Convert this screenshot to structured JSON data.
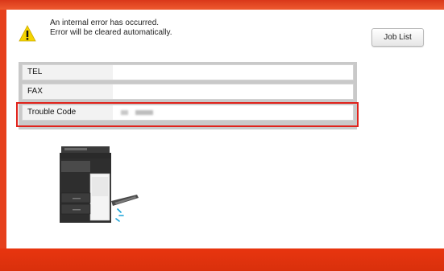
{
  "message": {
    "line1": "An internal error has occurred.",
    "line2": "Error will be cleared automatically."
  },
  "job_list_button": "Job List",
  "info_rows": [
    {
      "label": "TEL",
      "value": ""
    },
    {
      "label": "FAX",
      "value": ""
    },
    {
      "label": "Trouble Code",
      "value": ""
    }
  ],
  "icons": {
    "warning": "warning-icon",
    "printer": "printer-illustration"
  },
  "colors": {
    "frame": "#e6401c",
    "highlight_border": "#e0221b",
    "warning_yellow": "#f5d400"
  }
}
